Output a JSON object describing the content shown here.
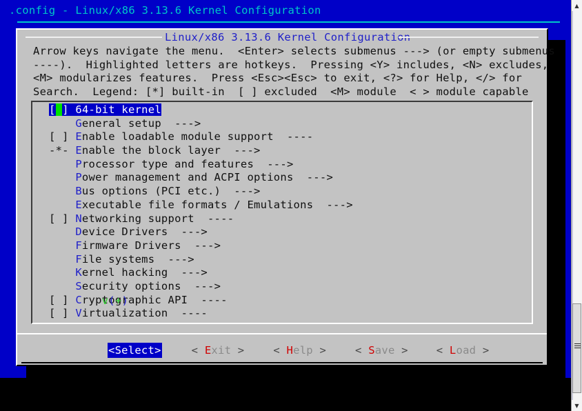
{
  "window": {
    "title": ".config - Linux/x86 3.13.6 Kernel Configuration",
    "background_color": "#0000c8",
    "title_color": "#00c8c8"
  },
  "dialog": {
    "title": "Linux/x86 3.13.6 Kernel Configuration",
    "title_color": "#2020c8",
    "background_color": "#c3c3c3",
    "help_text": "Arrow keys navigate the menu.  <Enter> selects submenus ---> (or empty submenus\n----).  Highlighted letters are hotkeys.  Pressing <Y> includes, <N> excludes,\n<M> modularizes features.  Press <Esc><Esc> to exit, <?> for Help, </> for\nSearch.  Legend: [*] built-in  [ ] excluded  <M> module  < > module capable"
  },
  "menu": {
    "selected_index": 0,
    "selection_bg": "#0000c8",
    "selection_fg": "#ffffff",
    "cursor_color": "#00e000",
    "hotkey_color": "#2020c8",
    "items": [
      {
        "mark": "[ ]",
        "hotkey": "6",
        "rest": "4-bit kernel",
        "suffix": "",
        "selected": true
      },
      {
        "mark": "   ",
        "hotkey": "G",
        "rest": "eneral setup",
        "suffix": "  --->"
      },
      {
        "mark": "[ ]",
        "hotkey": "E",
        "rest": "nable loadable module support",
        "suffix": "  ----"
      },
      {
        "mark": "-*-",
        "hotkey": "E",
        "rest": "nable the block layer",
        "suffix": "  --->"
      },
      {
        "mark": "   ",
        "hotkey": "P",
        "rest": "rocessor type and features",
        "suffix": "  --->"
      },
      {
        "mark": "   ",
        "hotkey": "P",
        "rest": "ower management and ACPI options",
        "suffix": "  --->"
      },
      {
        "mark": "   ",
        "hotkey": "B",
        "rest": "us options (PCI etc.)",
        "suffix": "  --->"
      },
      {
        "mark": "   ",
        "hotkey": "E",
        "rest": "xecutable file formats / Emulations",
        "suffix": "  --->"
      },
      {
        "mark": "[ ]",
        "hotkey": "N",
        "rest": "etworking support",
        "suffix": "  ----"
      },
      {
        "mark": "   ",
        "hotkey": "D",
        "rest": "evice Drivers",
        "suffix": "  --->"
      },
      {
        "mark": "   ",
        "hotkey": "F",
        "rest": "irmware Drivers",
        "suffix": "  --->"
      },
      {
        "mark": "   ",
        "hotkey": "F",
        "rest": "ile systems",
        "suffix": "  --->"
      },
      {
        "mark": "   ",
        "hotkey": "K",
        "rest": "ernel hacking",
        "suffix": "  --->"
      },
      {
        "mark": "   ",
        "hotkey": "S",
        "rest": "ecurity options",
        "suffix": "  --->"
      },
      {
        "mark": "[ ]",
        "hotkey": "C",
        "rest": "ryptographic API",
        "suffix": "  ----"
      },
      {
        "mark": "[ ]",
        "hotkey": "V",
        "rest": "irtualization",
        "suffix": "  ----"
      }
    ],
    "scroll_hint": {
      "v": "v",
      "open": "(",
      "plus": "+",
      "close": ")"
    }
  },
  "buttons": [
    {
      "label": "<Select>",
      "selected": true
    },
    {
      "left": "<",
      "hotkey": "E",
      "rest": "xit",
      "right": ">",
      "selected": false
    },
    {
      "left": "<",
      "hotkey": "H",
      "rest": "elp",
      "right": ">",
      "selected": false
    },
    {
      "left": "<",
      "hotkey": "S",
      "rest": "ave",
      "right": ">",
      "selected": false
    },
    {
      "left": "<",
      "hotkey": "L",
      "rest": "oad",
      "right": ">",
      "selected": false
    }
  ],
  "button_hotkey_color": "#d00000",
  "scrollbar": {
    "up_arrow": "▲",
    "down_arrow": "▼"
  }
}
